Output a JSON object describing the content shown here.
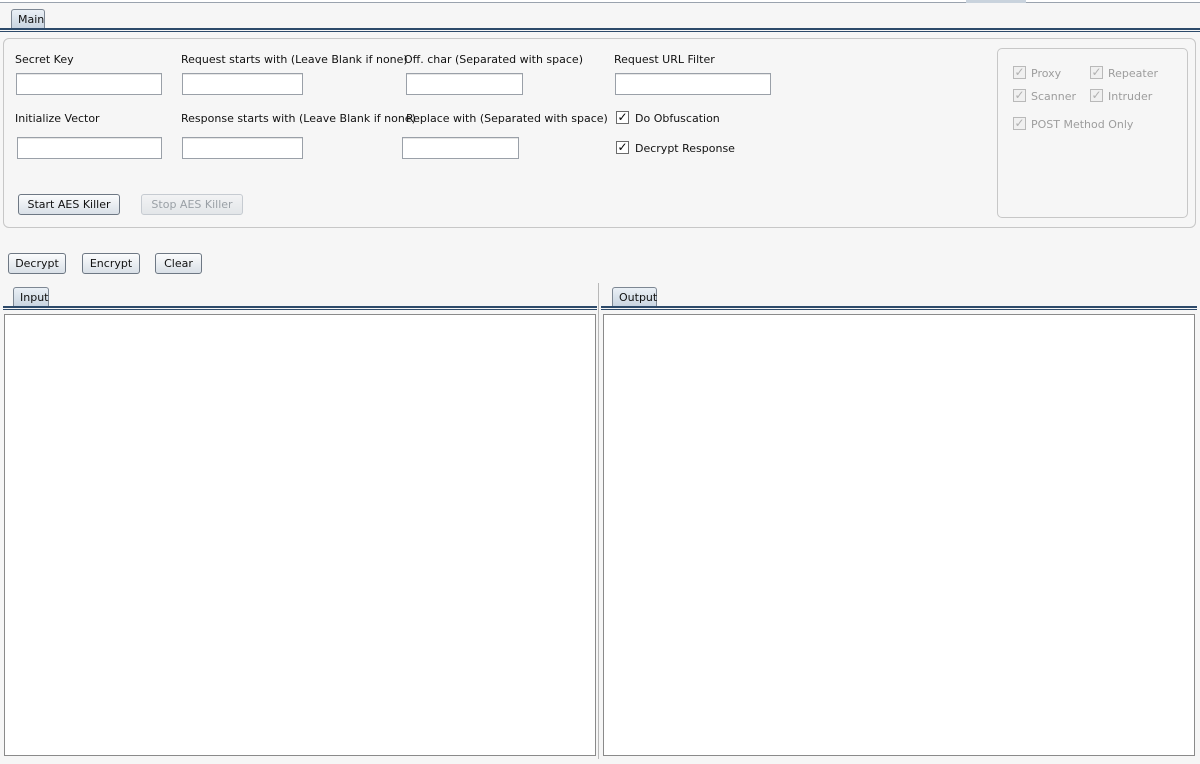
{
  "tabs": {
    "main": "Main"
  },
  "form": {
    "secret_key": {
      "label": "Secret Key",
      "value": ""
    },
    "request_starts": {
      "label": "Request starts with (Leave Blank if none)",
      "value": ""
    },
    "off_char": {
      "label": "Off. char (Separated with space)",
      "value": ""
    },
    "request_url_filter": {
      "label": "Request URL Filter",
      "value": ""
    },
    "init_vector": {
      "label": "Initialize Vector",
      "value": ""
    },
    "response_starts": {
      "label": "Response starts with (Leave Blank if none)",
      "value": ""
    },
    "replace_with": {
      "label": "Replace with (Separated with space)",
      "value": ""
    },
    "do_obfuscation": {
      "label": "Do Obfuscation",
      "checked": true
    },
    "decrypt_response": {
      "label": "Decrypt Response",
      "checked": true
    },
    "start_button": "Start AES Killer",
    "stop_button": "Stop AES Killer"
  },
  "tools": {
    "proxy": {
      "label": "Proxy",
      "checked": true,
      "enabled": false
    },
    "repeater": {
      "label": "Repeater",
      "checked": true,
      "enabled": false
    },
    "scanner": {
      "label": "Scanner",
      "checked": true,
      "enabled": false
    },
    "intruder": {
      "label": "Intruder",
      "checked": true,
      "enabled": false
    },
    "post_only": {
      "label": "POST Method Only",
      "checked": true,
      "enabled": false
    }
  },
  "actions": {
    "decrypt": "Decrypt",
    "encrypt": "Encrypt",
    "clear": "Clear"
  },
  "panes": {
    "input": {
      "tab": "Input",
      "content": ""
    },
    "output": {
      "tab": "Output",
      "content": ""
    }
  },
  "colors": {
    "tab_underline": "#2d4a6a",
    "tab_fill": "#c7d3df"
  }
}
